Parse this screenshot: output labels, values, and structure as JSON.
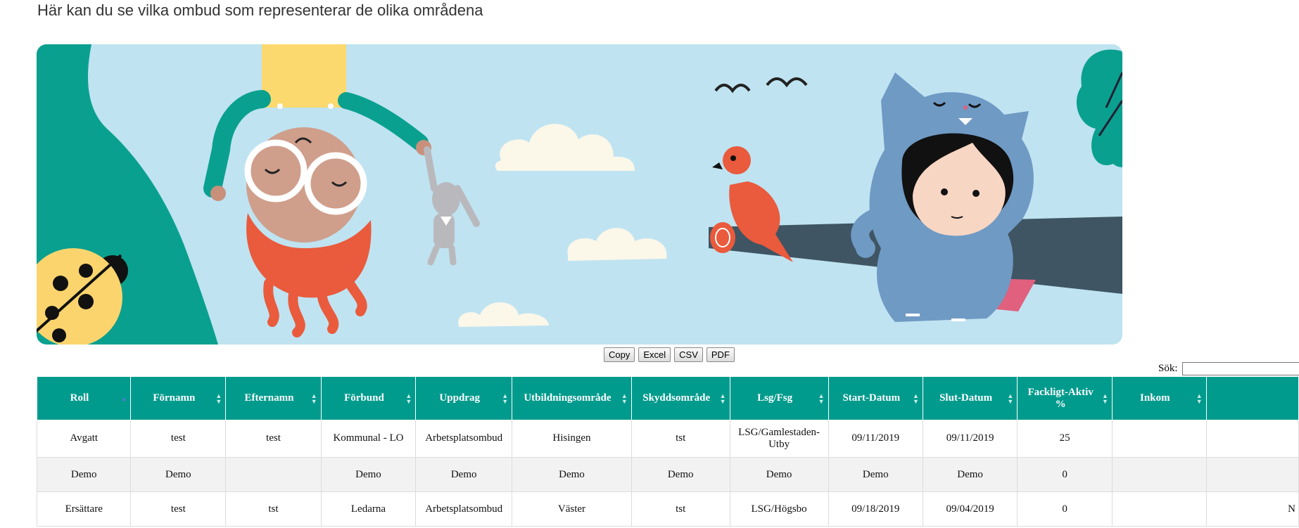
{
  "intro": "Här kan du se vilka ombud som representerar de olika områdena",
  "export_buttons": [
    "Copy",
    "Excel",
    "CSV",
    "PDF"
  ],
  "search": {
    "label": "Sök:",
    "value": ""
  },
  "table": {
    "headers": [
      "Roll",
      "Förnamn",
      "Efternamn",
      "Förbund",
      "Uppdrag",
      "Utbildningsområde",
      "Skyddsområde",
      "Lsg/Fsg",
      "Start-Datum",
      "Slut-Datum",
      "Fackligt-Aktiv %",
      "Inkom",
      ""
    ],
    "rows": [
      [
        "Avgatt",
        "test",
        "test",
        "Kommunal - LO",
        "Arbetsplatsombud",
        "Hisingen",
        "tst",
        "LSG/Gamlestaden-Utby",
        "09/11/2019",
        "09/11/2019",
        "25",
        "",
        ""
      ],
      [
        "Demo",
        "Demo",
        "",
        "Demo",
        "Demo",
        "Demo",
        "Demo",
        "Demo",
        "Demo",
        "Demo",
        "0",
        "",
        ""
      ],
      [
        "Ersättare",
        "test",
        "tst",
        "Ledarna",
        "Arbetsplatsombud",
        "Väster",
        "tst",
        "LSG/Högsbo",
        "09/18/2019",
        "09/04/2019",
        "0",
        "",
        "N"
      ]
    ]
  },
  "colors": {
    "header_bg": "#009b8d",
    "sky": "#bfe3f1",
    "teal": "#0aa08f",
    "bird": "#e85d44",
    "branch": "#3f5563",
    "monster": "#6f9ac4"
  }
}
